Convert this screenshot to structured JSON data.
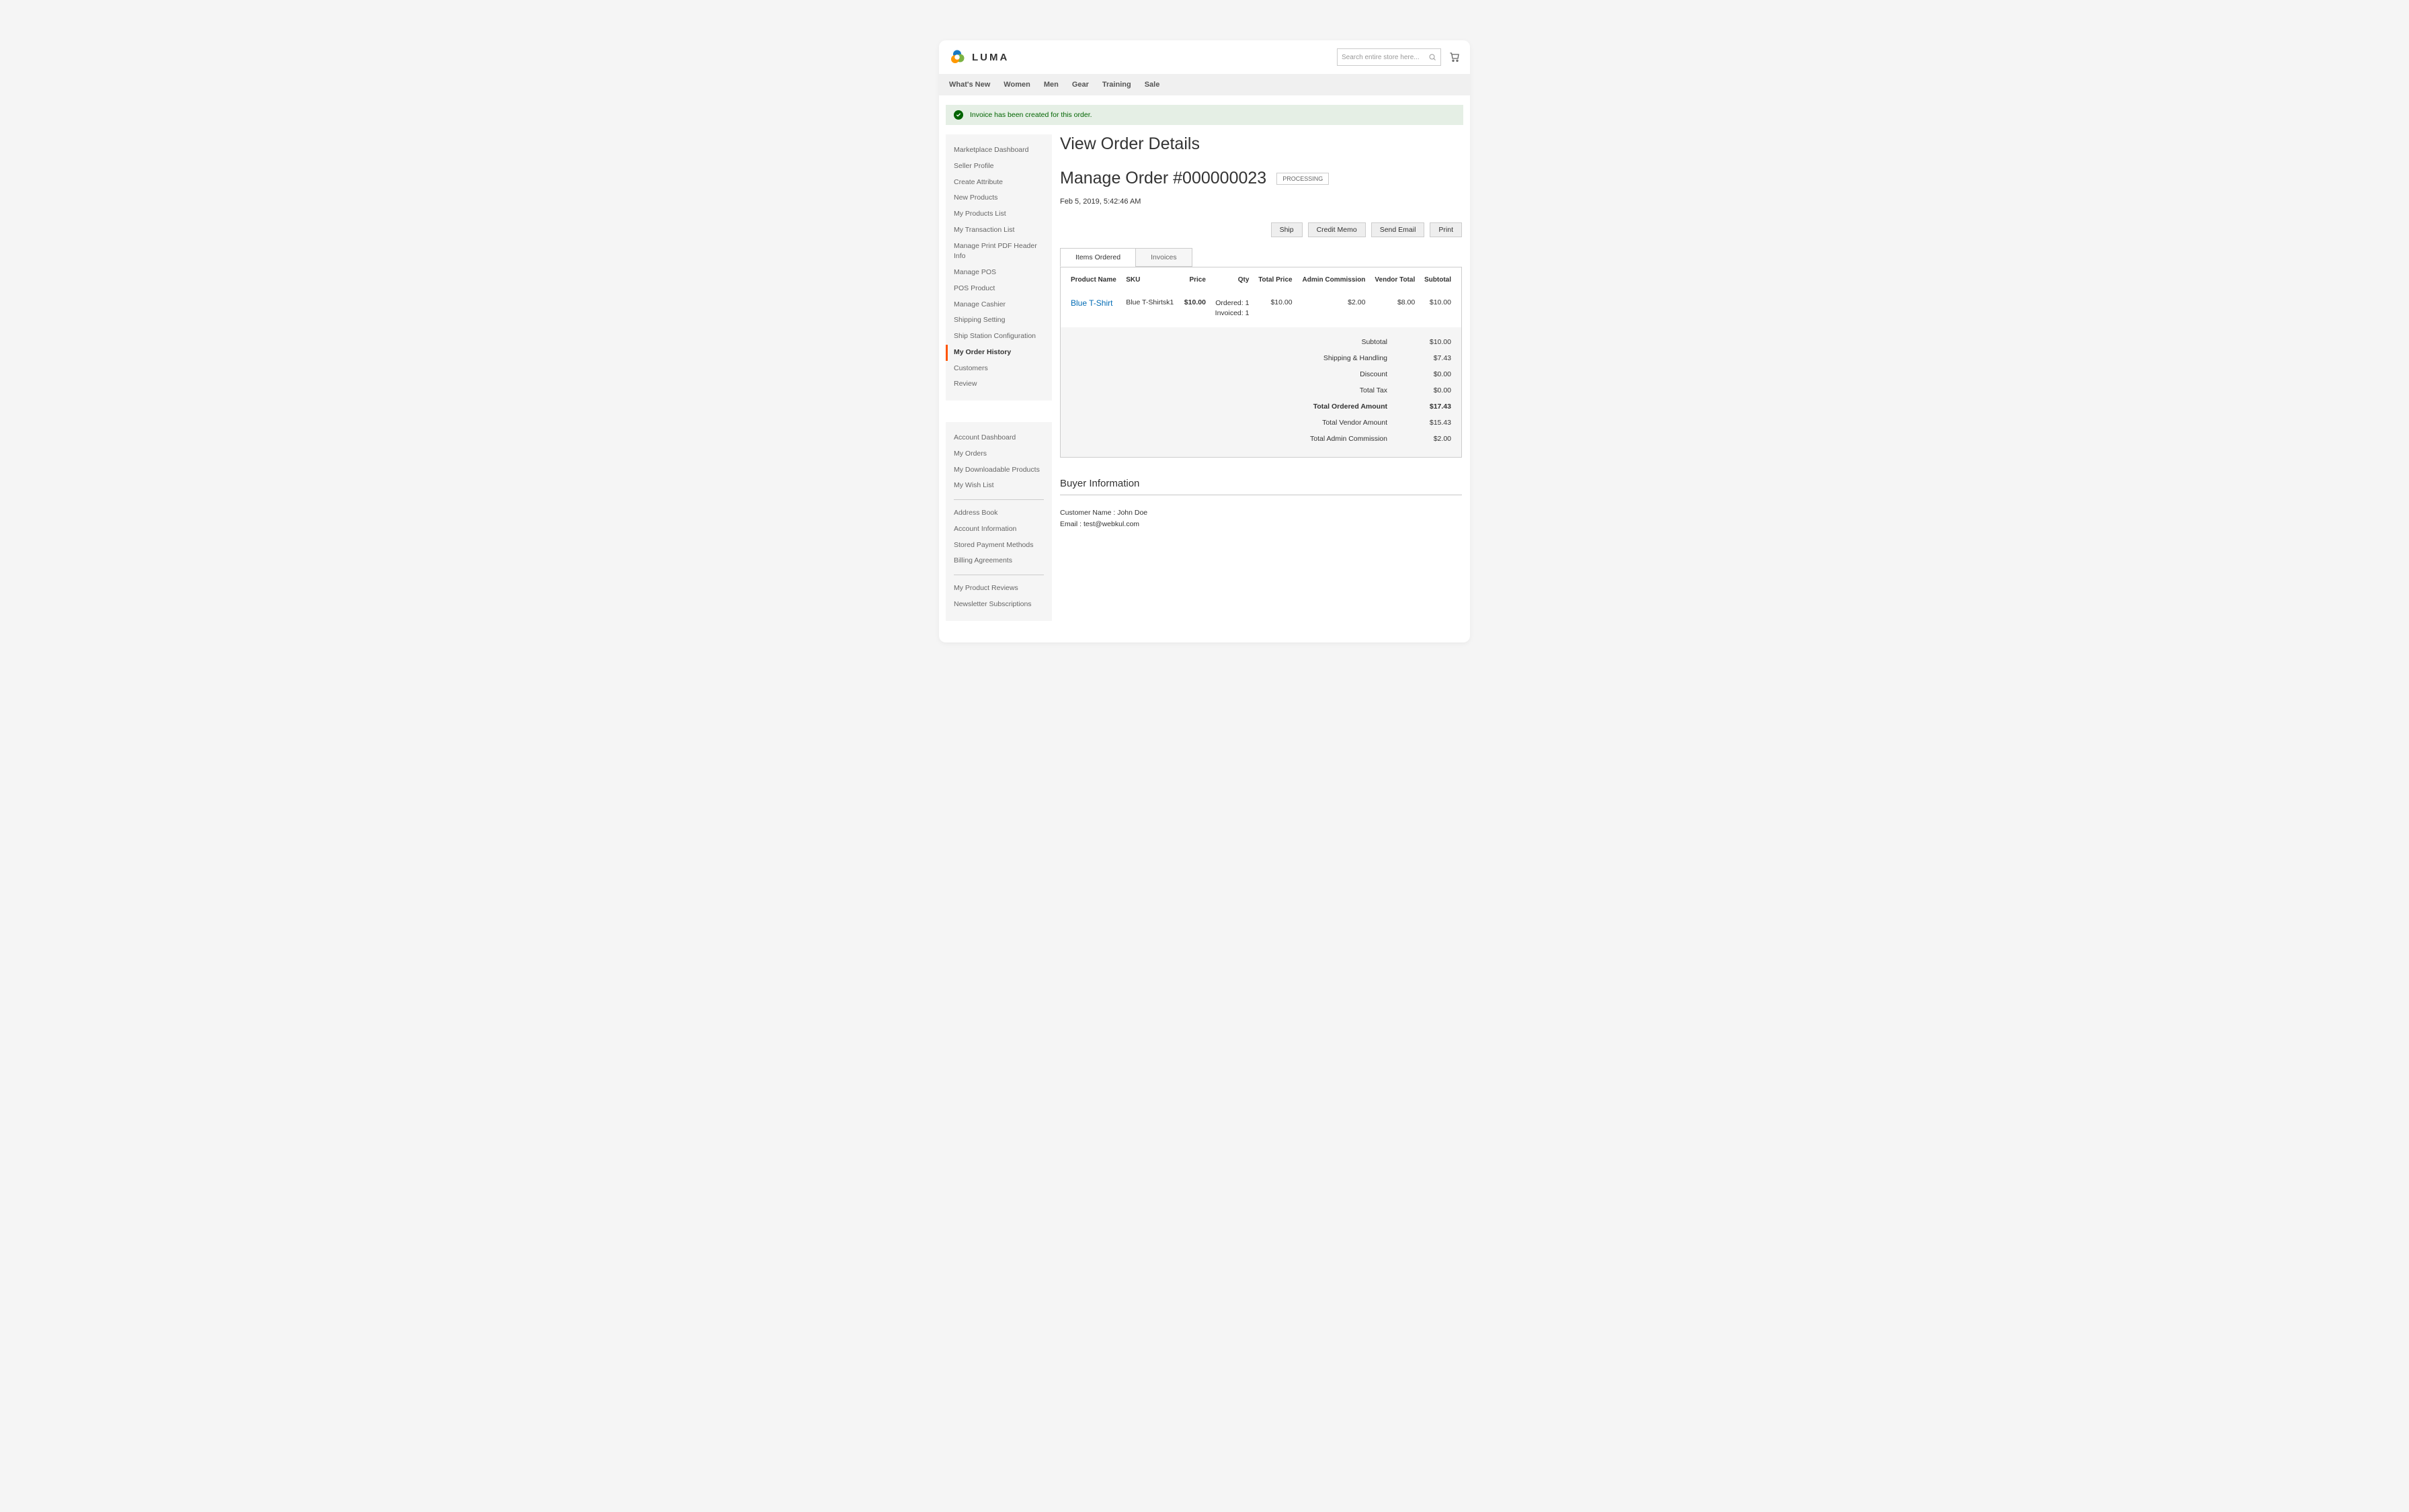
{
  "brand": "LUMA",
  "search": {
    "placeholder": "Search entire store here..."
  },
  "topnav": [
    "What's New",
    "Women",
    "Men",
    "Gear",
    "Training",
    "Sale"
  ],
  "alert": "Invoice has been created for this order.",
  "sidebar1": [
    "Marketplace Dashboard",
    "Seller Profile",
    "Create Attribute",
    "New Products",
    "My Products List",
    "My Transaction List",
    "Manage Print PDF Header Info",
    "Manage POS",
    "POS Product",
    "Manage Cashier",
    "Shipping Setting",
    "Ship Station Configuration",
    "My Order History",
    "Customers",
    "Review"
  ],
  "sidebar1_active_index": 12,
  "sidebar2_g1": [
    "Account Dashboard",
    "My Orders",
    "My Downloadable Products",
    "My Wish List"
  ],
  "sidebar2_g2": [
    "Address Book",
    "Account Information",
    "Stored Payment Methods",
    "Billing Agreements"
  ],
  "sidebar2_g3": [
    "My Product Reviews",
    "Newsletter Subscriptions"
  ],
  "page_title": "View Order Details",
  "order": {
    "title": "Manage Order #000000023",
    "status": "PROCESSING",
    "date": "Feb 5, 2019, 5:42:46 AM"
  },
  "actions": {
    "ship": "Ship",
    "creditmemo": "Credit Memo",
    "sendemail": "Send Email",
    "print": "Print"
  },
  "tabs": {
    "items": "Items Ordered",
    "invoices": "Invoices"
  },
  "table": {
    "headers": {
      "product": "Product Name",
      "sku": "SKU",
      "price": "Price",
      "qty": "Qty",
      "total": "Total Price",
      "admin": "Admin Commission",
      "vendor": "Vendor Total",
      "subtotal": "Subtotal"
    },
    "row": {
      "product": "Blue T-Shirt",
      "sku": "Blue T-Shirtsk1",
      "price": "$10.00",
      "qty_ordered": "Ordered: 1",
      "qty_invoiced": "Invoiced: 1",
      "total": "$10.00",
      "admin": "$2.00",
      "vendor": "$8.00",
      "subtotal": "$10.00"
    }
  },
  "summary": {
    "subtotal": {
      "label": "Subtotal",
      "val": "$10.00"
    },
    "shipping": {
      "label": "Shipping & Handling",
      "val": "$7.43"
    },
    "discount": {
      "label": "Discount",
      "val": "$0.00"
    },
    "tax": {
      "label": "Total Tax",
      "val": "$0.00"
    },
    "ordered": {
      "label": "Total Ordered Amount",
      "val": "$17.43"
    },
    "vendor": {
      "label": "Total Vendor Amount",
      "val": "$15.43"
    },
    "admin": {
      "label": "Total Admin Commission",
      "val": "$2.00"
    }
  },
  "buyer": {
    "title": "Buyer Information",
    "name_line": "Customer Name : John Doe",
    "email_line": "Email : test@webkul.com"
  }
}
